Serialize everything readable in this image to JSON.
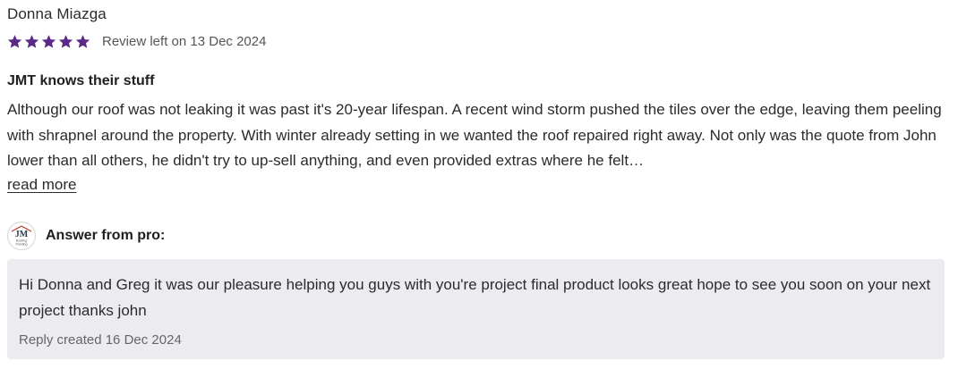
{
  "review": {
    "reviewer_name": "Donna Miazga",
    "rating": 5,
    "rating_max": 5,
    "star_color": "#5b2a86",
    "date_text": "Review left on 13 Dec 2024",
    "title": "JMT knows their stuff",
    "body": "Although our roof was not leaking it was past it's 20-year lifespan. A recent wind storm pushed the tiles over the edge, leaving them peeling with shrapnel around the property. With winter already setting in we wanted the roof repaired right away. Not only was the quote from John lower than all others, he didn't try to up-sell anything, and even provided extras where he felt…",
    "read_more_label": "read more"
  },
  "answer": {
    "label": "Answer from pro:",
    "logo": {
      "icon": "jmt-roofing-logo",
      "monogram": "JM",
      "lines": [
        "Roofing",
        "Painting"
      ]
    },
    "reply_text": "Hi Donna and Greg it was our pleasure helping you guys with you're project final product looks great hope to see you soon on your next project thanks john",
    "reply_date_text": "Reply created 16 Dec 2024"
  }
}
